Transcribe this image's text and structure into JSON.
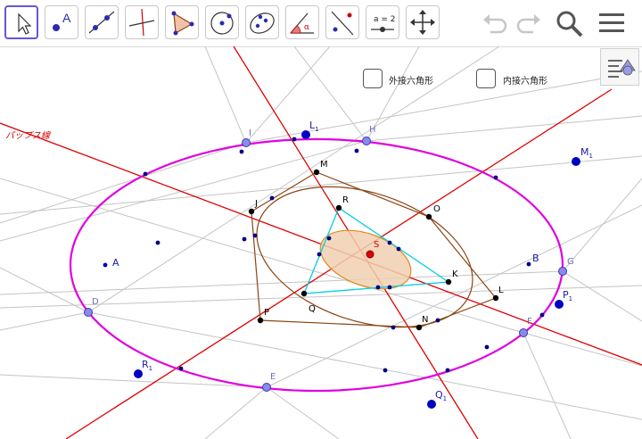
{
  "toolbar": {
    "tools": [
      {
        "name": "move-tool",
        "label": "",
        "selected": true
      },
      {
        "name": "point-tool",
        "label": "A",
        "selected": false
      },
      {
        "name": "line-tool",
        "label": "",
        "selected": false
      },
      {
        "name": "perpendicular-tool",
        "label": "",
        "selected": false
      },
      {
        "name": "polygon-tool",
        "label": "",
        "selected": false
      },
      {
        "name": "circle-tool",
        "label": "",
        "selected": false
      },
      {
        "name": "ellipse-tool",
        "label": "",
        "selected": false
      },
      {
        "name": "angle-tool",
        "label": "α",
        "selected": false
      },
      {
        "name": "reflect-tool",
        "label": "",
        "selected": false
      },
      {
        "name": "slider-tool",
        "label": "a = 2",
        "selected": false
      },
      {
        "name": "move-view-tool",
        "label": "",
        "selected": false
      }
    ],
    "undo_icon": "undo-icon",
    "redo_icon": "redo-icon",
    "search_icon": "search-icon",
    "menu_icon": "menu-icon"
  },
  "checkboxes": [
    {
      "label": "外接六角形",
      "checked": false
    },
    {
      "label": "内接六角形",
      "checked": false
    }
  ],
  "line_label": "パップス線",
  "points": {
    "I": "I",
    "H": "H",
    "G": "G",
    "F": "F",
    "E": "E",
    "D": "D",
    "J": "J",
    "M": "M",
    "O": "O",
    "L": "L",
    "N": "N",
    "P": "P",
    "R": "R",
    "S": "S",
    "K": "K",
    "Q": "Q",
    "A": "A",
    "B": "B"
  },
  "sub_points": [
    {
      "base": "L",
      "sub": "1"
    },
    {
      "base": "M",
      "sub": "1"
    },
    {
      "base": "P",
      "sub": "1"
    },
    {
      "base": "Q",
      "sub": "1"
    },
    {
      "base": "R",
      "sub": "1"
    }
  ],
  "colors": {
    "ellipse": "#e000e0",
    "pappus_line": "#e00000",
    "hexagon": "#8b4513",
    "triangle": "#00d0e0",
    "inner_ellipse_fill": "#f0d0b0",
    "point_blue": "#0000c0",
    "point_ring": "#6b6bd6"
  }
}
